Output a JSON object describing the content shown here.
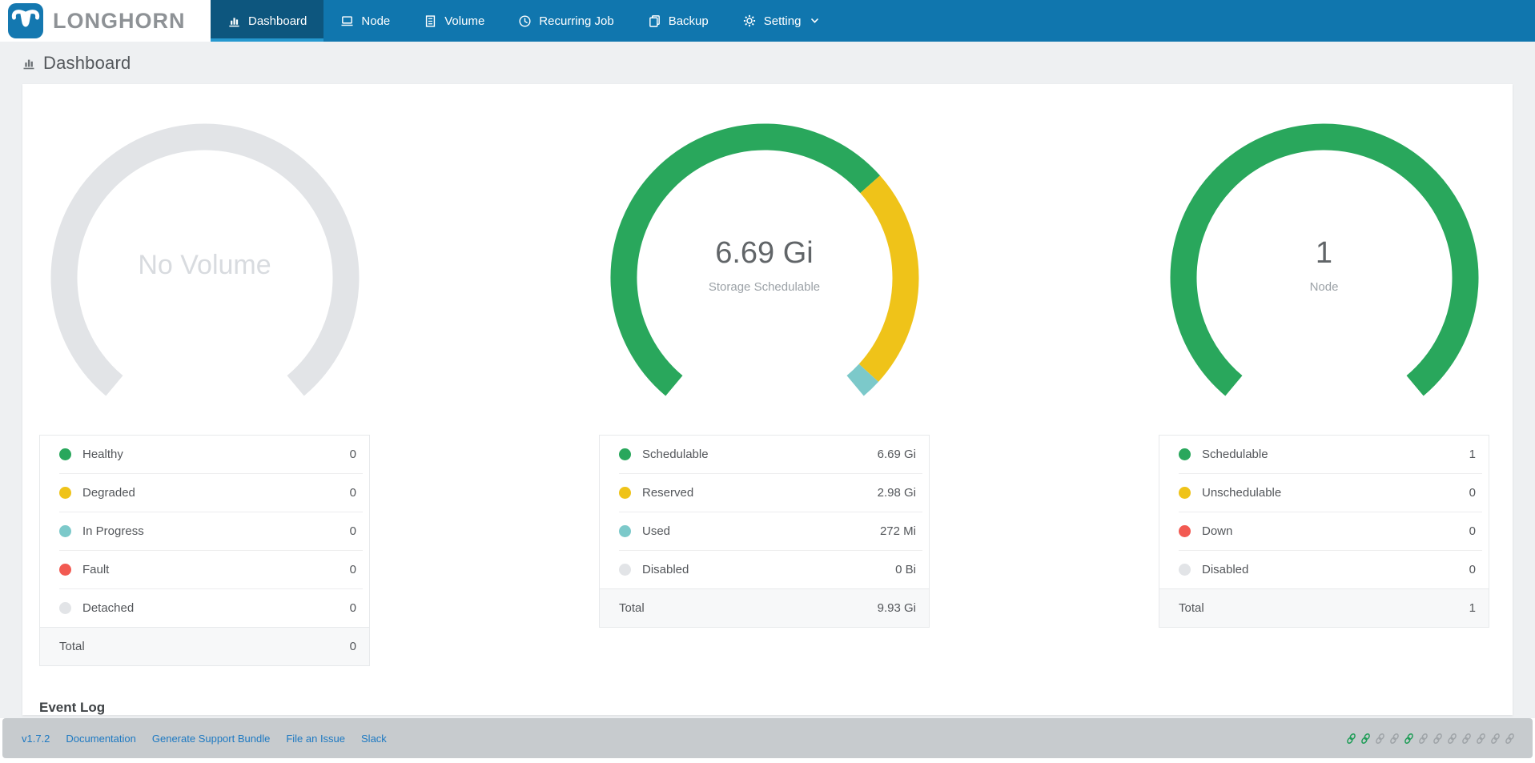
{
  "brand": {
    "name": "LONGHORN"
  },
  "nav": {
    "items": [
      {
        "label": "Dashboard",
        "active": true
      },
      {
        "label": "Node",
        "active": false
      },
      {
        "label": "Volume",
        "active": false
      },
      {
        "label": "Recurring Job",
        "active": false
      },
      {
        "label": "Backup",
        "active": false
      },
      {
        "label": "Setting",
        "active": false,
        "has_dropdown": true
      }
    ]
  },
  "page": {
    "title": "Dashboard"
  },
  "colors": {
    "green": "#29a75c",
    "yellow": "#efc319",
    "teal": "#7cc9ca",
    "red": "#f25a52",
    "gray": "#e2e4e7",
    "gauge_empty": "#e2e4e7",
    "navbar": "#1076ae",
    "active_tab": "#0d567e",
    "active_underline": "#2598cf",
    "footer_link": "#1d79c2"
  },
  "panels": [
    {
      "gauge": {
        "type": "empty",
        "center_value": "",
        "center_label": "No Volume",
        "segments": []
      },
      "table": {
        "rows": [
          {
            "label": "Healthy",
            "value": "0",
            "color": "green"
          },
          {
            "label": "Degraded",
            "value": "0",
            "color": "yellow"
          },
          {
            "label": "In Progress",
            "value": "0",
            "color": "teal"
          },
          {
            "label": "Fault",
            "value": "0",
            "color": "red"
          },
          {
            "label": "Detached",
            "value": "0",
            "color": "gray"
          }
        ],
        "total_label": "Total",
        "total_value": "0"
      }
    },
    {
      "gauge": {
        "type": "donut",
        "center_value": "6.69 Gi",
        "center_label": "Storage Schedulable",
        "segments": [
          {
            "name": "Schedulable",
            "color": "green",
            "fraction": 0.673
          },
          {
            "name": "Reserved",
            "color": "yellow",
            "fraction": 0.3
          },
          {
            "name": "Used",
            "color": "teal",
            "fraction": 0.027
          }
        ]
      },
      "table": {
        "rows": [
          {
            "label": "Schedulable",
            "value": "6.69 Gi",
            "color": "green"
          },
          {
            "label": "Reserved",
            "value": "2.98 Gi",
            "color": "yellow"
          },
          {
            "label": "Used",
            "value": "272 Mi",
            "color": "teal"
          },
          {
            "label": "Disabled",
            "value": "0 Bi",
            "color": "gray"
          }
        ],
        "total_label": "Total",
        "total_value": "9.93 Gi"
      }
    },
    {
      "gauge": {
        "type": "donut",
        "center_value": "1",
        "center_label": "Node",
        "segments": [
          {
            "name": "Schedulable",
            "color": "green",
            "fraction": 1
          }
        ]
      },
      "table": {
        "rows": [
          {
            "label": "Schedulable",
            "value": "1",
            "color": "green"
          },
          {
            "label": "Unschedulable",
            "value": "0",
            "color": "yellow"
          },
          {
            "label": "Down",
            "value": "0",
            "color": "red"
          },
          {
            "label": "Disabled",
            "value": "0",
            "color": "gray"
          }
        ],
        "total_label": "Total",
        "total_value": "1"
      }
    }
  ],
  "chart_data": [
    {
      "type": "pie",
      "title": "No Volume",
      "categories": [
        "Healthy",
        "Degraded",
        "In Progress",
        "Fault",
        "Detached"
      ],
      "values": [
        0,
        0,
        0,
        0,
        0
      ],
      "total": 0
    },
    {
      "type": "pie",
      "title": "Storage Schedulable",
      "categories": [
        "Schedulable",
        "Reserved",
        "Used",
        "Disabled"
      ],
      "values_display": [
        "6.69 Gi",
        "2.98 Gi",
        "272 Mi",
        "0 Bi"
      ],
      "values_gi": [
        6.69,
        2.98,
        0.27,
        0
      ],
      "total": "9.93 Gi"
    },
    {
      "type": "pie",
      "title": "Node",
      "categories": [
        "Schedulable",
        "Unschedulable",
        "Down",
        "Disabled"
      ],
      "values": [
        1,
        0,
        0,
        0
      ],
      "total": 1
    }
  ],
  "event_log": {
    "title": "Event Log"
  },
  "footer": {
    "version": "v1.7.2",
    "links": [
      "Documentation",
      "Generate Support Bundle",
      "File an Issue",
      "Slack"
    ],
    "link_icons": [
      "green",
      "green",
      "gray",
      "gray",
      "green",
      "gray",
      "gray",
      "gray",
      "gray",
      "gray",
      "gray",
      "gray"
    ]
  }
}
